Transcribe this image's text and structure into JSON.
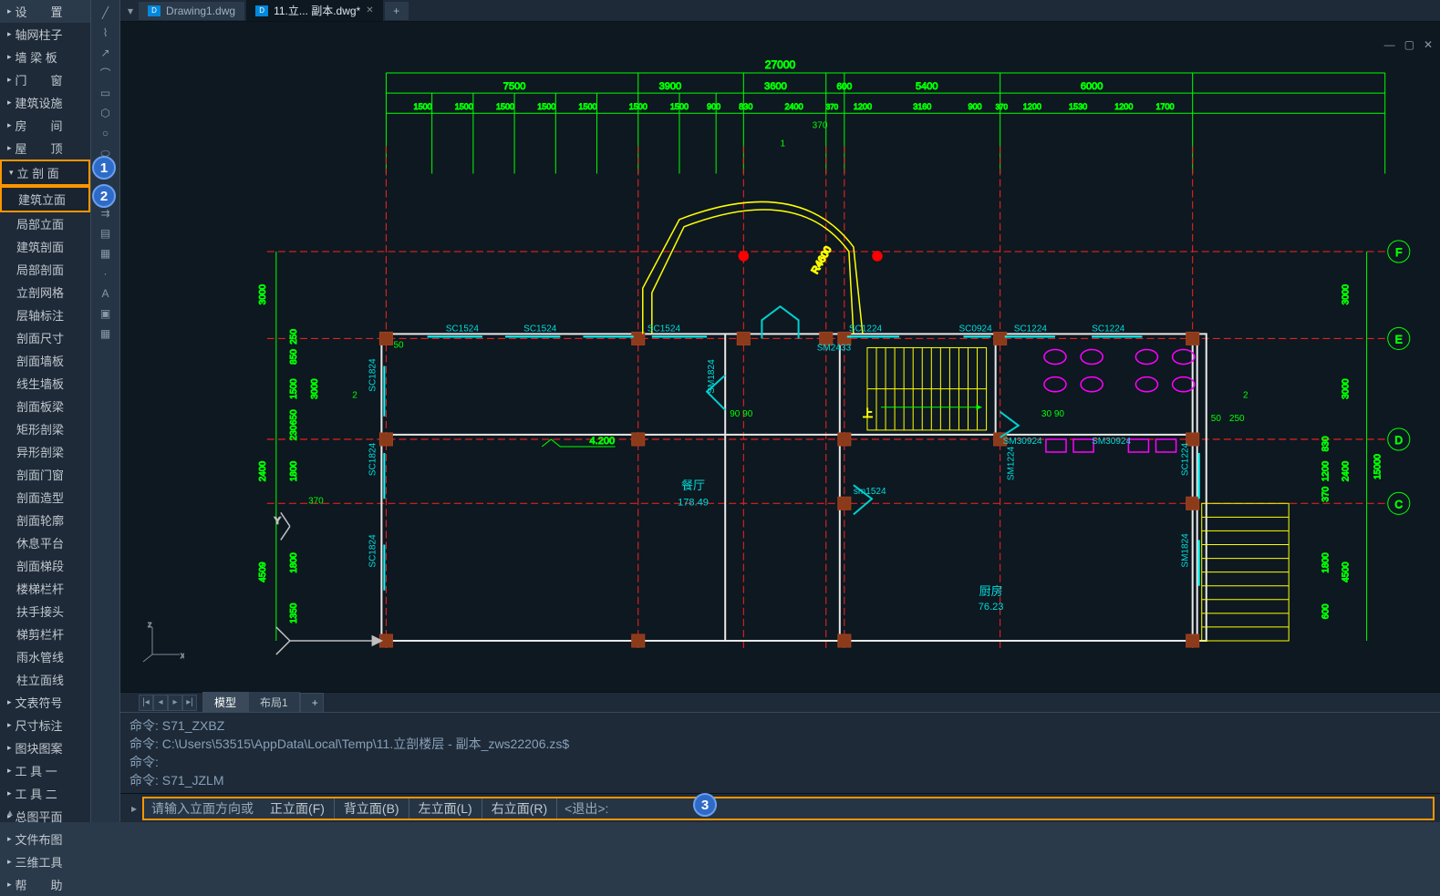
{
  "sidebar": {
    "top": [
      {
        "label": "设　　置",
        "expand": true
      },
      {
        "label": "轴网柱子",
        "expand": true
      },
      {
        "label": "墙 梁 板",
        "expand": true
      },
      {
        "label": "门　　窗",
        "expand": true
      },
      {
        "label": "建筑设施",
        "expand": true
      },
      {
        "label": "房　　间",
        "expand": true
      },
      {
        "label": "屋　　顶",
        "expand": true
      }
    ],
    "section_header": {
      "label": "立 剖 面"
    },
    "section_items": [
      {
        "label": "建筑立面",
        "highlighted": true
      },
      {
        "label": "局部立面"
      },
      {
        "label": "建筑剖面"
      },
      {
        "label": "局部剖面"
      }
    ],
    "group2": [
      {
        "label": "立剖网格"
      },
      {
        "label": "层轴标注"
      },
      {
        "label": "剖面尺寸"
      }
    ],
    "group3": [
      {
        "label": "剖面墙板"
      },
      {
        "label": "线生墙板"
      },
      {
        "label": "剖面板梁"
      },
      {
        "label": "矩形剖梁"
      },
      {
        "label": "异形剖梁"
      },
      {
        "label": "剖面门窗"
      },
      {
        "label": "剖面造型"
      },
      {
        "label": "剖面轮廓"
      }
    ],
    "group4": [
      {
        "label": "休息平台"
      },
      {
        "label": "剖面梯段"
      },
      {
        "label": "楼梯栏杆"
      },
      {
        "label": "扶手接头"
      },
      {
        "label": "梯剪栏杆"
      }
    ],
    "group5": [
      {
        "label": "雨水管线"
      },
      {
        "label": "柱立面线"
      }
    ],
    "bottom": [
      {
        "label": "文表符号",
        "expand": true
      },
      {
        "label": "尺寸标注",
        "expand": true
      },
      {
        "label": "图块图案",
        "expand": true
      },
      {
        "label": "工 具 一",
        "expand": true
      },
      {
        "label": "工 具 二",
        "expand": true
      },
      {
        "label": "总图平面",
        "expand": true
      },
      {
        "label": "文件布图",
        "expand": true
      },
      {
        "label": "三维工具",
        "expand": true
      },
      {
        "label": "帮　　助",
        "expand": true
      }
    ]
  },
  "tabs": [
    {
      "label": "Drawing1.dwg",
      "active": false
    },
    {
      "label": "11.立... 副本.dwg*",
      "active": true
    }
  ],
  "layout_tabs": {
    "model": "模型",
    "layouts": [
      "布局1"
    ],
    "add": "+"
  },
  "cmd_history": [
    "命令: S71_ZXBZ",
    "命令: C:\\Users\\53515\\AppData\\Local\\Temp\\11.立剖楼层 - 副本_zws22206.zs$",
    "命令:",
    "命令: S71_JZLM"
  ],
  "cmd_prompt": {
    "lead": "请输入立面方向或",
    "options": [
      "正立面(F)",
      "背立面(B)",
      "左立面(L)",
      "右立面(R)"
    ],
    "exit": "<退出>:"
  },
  "drawing": {
    "top_dim": "27000",
    "spans": [
      "7500",
      "3900",
      "3600",
      "600",
      "5400",
      "6000"
    ],
    "sub_dims": [
      "1500",
      "1500",
      "1500",
      "1500",
      "1500",
      "1500",
      "1500",
      "900",
      "830",
      "2400",
      "370",
      "1200",
      "3160",
      "900",
      "370",
      "1200",
      "1530",
      "1200",
      "1700"
    ],
    "right_dim": "15000",
    "left_vert": [
      "3000",
      "2400",
      "4509"
    ],
    "left_sub": [
      "250",
      "850",
      "1500",
      "650",
      "230",
      "1800",
      "1800",
      "1350"
    ],
    "right_vert": [
      "3000",
      "3000",
      "2400",
      "4500"
    ],
    "right_sub": [
      "830",
      "1200",
      "370",
      "1800",
      "600"
    ],
    "axes_right": [
      "F",
      "E",
      "D",
      "C"
    ],
    "windows": [
      "SC1524",
      "SC1524",
      "SC1524",
      "SC1224",
      "SC0924",
      "SC1224",
      "SC1224",
      "SC1824",
      "SC1824",
      "SM1824",
      "SC1224",
      "SM1824",
      "SM1224",
      "SM30924",
      "SM30924",
      "sm1524"
    ],
    "door": "SM2433",
    "rooms": [
      {
        "name": "餐厅",
        "area": "178.49"
      },
      {
        "name": "厨房",
        "area": "76.23"
      }
    ],
    "radius": "R4600",
    "elev": "4.200",
    "stairs_up": "上",
    "marks": [
      "90  90",
      "30  90",
      "50",
      "370",
      "2",
      "250",
      "370",
      "1",
      "50",
      "250"
    ]
  },
  "badges": {
    "b1": "1",
    "b2": "2",
    "b3": "3"
  }
}
